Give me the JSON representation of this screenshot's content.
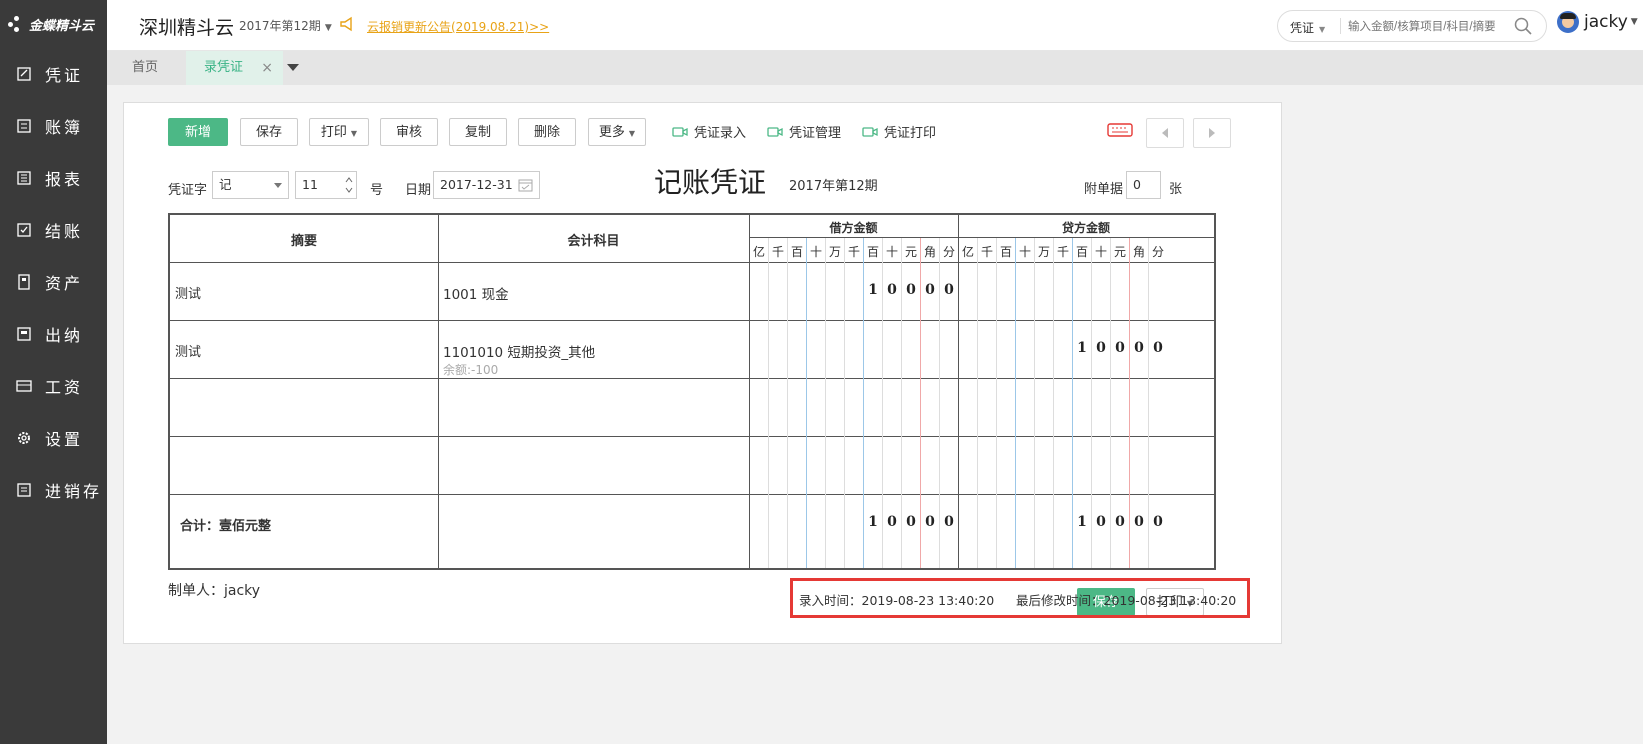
{
  "app": {
    "logo_text": "金蝶精斗云",
    "company": "深圳精斗云",
    "period": "2017年第12期",
    "announcement": "云报销更新公告(2019.08.21)>>"
  },
  "sidebar": {
    "items": [
      {
        "label": "凭证",
        "icon": "voucher-icon"
      },
      {
        "label": "账簿",
        "icon": "ledger-icon"
      },
      {
        "label": "报表",
        "icon": "report-icon"
      },
      {
        "label": "结账",
        "icon": "checkout-icon"
      },
      {
        "label": "资产",
        "icon": "asset-icon"
      },
      {
        "label": "出纳",
        "icon": "cashier-icon"
      },
      {
        "label": "工资",
        "icon": "payroll-icon"
      },
      {
        "label": "设置",
        "icon": "gear-icon"
      },
      {
        "label": "进销存",
        "icon": "inventory-icon"
      }
    ]
  },
  "search": {
    "category": "凭证",
    "placeholder": "输入金额/核算项目/科目/摘要"
  },
  "user": {
    "name": "jacky"
  },
  "tabs": {
    "home": "首页",
    "current": "录凭证"
  },
  "toolbar": {
    "add": "新增",
    "save": "保存",
    "print": "打印",
    "audit": "审核",
    "copy": "复制",
    "delete": "删除",
    "more": "更多",
    "links": [
      "凭证录入",
      "凭证管理",
      "凭证打印"
    ]
  },
  "voucher": {
    "word_label": "凭证字",
    "word_value": "记",
    "number_value": "11",
    "number_suffix": "号",
    "date_label": "日期",
    "date_value": "2017-12-31",
    "title": "记账凭证",
    "period": "2017年第12期",
    "attach_label": "附单据",
    "attach_value": "0",
    "attach_suffix": "张",
    "col_summary": "摘要",
    "col_account": "会计科目",
    "col_debit": "借方金额",
    "col_credit": "贷方金额",
    "units": [
      "亿",
      "千",
      "百",
      "十",
      "万",
      "千",
      "百",
      "十",
      "元",
      "角",
      "分"
    ],
    "rows": [
      {
        "summary": "测试",
        "account": "1001 现金",
        "balance": "",
        "debit": "10000",
        "credit": ""
      },
      {
        "summary": "测试",
        "account": "1101010 短期投资_其他",
        "balance": "余额:-100",
        "debit": "",
        "credit": "10000"
      },
      {
        "summary": "",
        "account": "",
        "balance": "",
        "debit": "",
        "credit": ""
      },
      {
        "summary": "",
        "account": "",
        "balance": "",
        "debit": "",
        "credit": ""
      }
    ],
    "total_label": "合计：壹佰元整",
    "total_debit": "10000",
    "total_credit": "10000",
    "maker": "制单人：jacky",
    "entry_time": "录入时间：2019-08-23 13:40:20",
    "modified_time": "最后修改时间：2019-08-23 13:40:20",
    "bottom_save": "保存",
    "bottom_print": "打印"
  },
  "colors": {
    "primary": "#4cb886",
    "sidebar": "#3a3a3a",
    "highlight": "#e53935",
    "announce": "#e8a317"
  }
}
